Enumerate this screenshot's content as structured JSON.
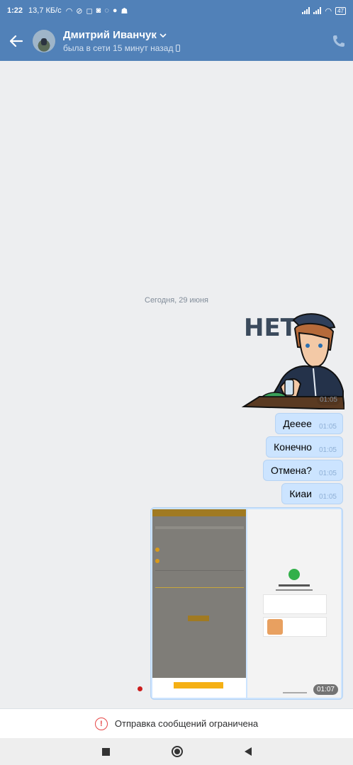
{
  "status_bar": {
    "time": "1:22",
    "net_speed": "13,7 КБ/с",
    "battery": "47"
  },
  "header": {
    "name": "Дмитрий Иванчук",
    "status": "была в сети 15 минут назад"
  },
  "chat": {
    "date_separator": "Сегодня, 29 июня",
    "sticker": {
      "text": "НЕТ.",
      "time": "01:05"
    },
    "messages": [
      {
        "text": "Дееее",
        "time": "01:05"
      },
      {
        "text": "Конечно",
        "time": "01:05"
      },
      {
        "text": "Отмена?",
        "time": "01:05"
      },
      {
        "text": "Киаи",
        "time": "01:05"
      }
    ],
    "photo_time": "01:07"
  },
  "restriction": {
    "text": "Отправка сообщений ограничена"
  },
  "colors": {
    "brand": "#5181b8",
    "bubble_out": "#cce4ff",
    "background": "#edeef0",
    "warning": "#e64646"
  }
}
